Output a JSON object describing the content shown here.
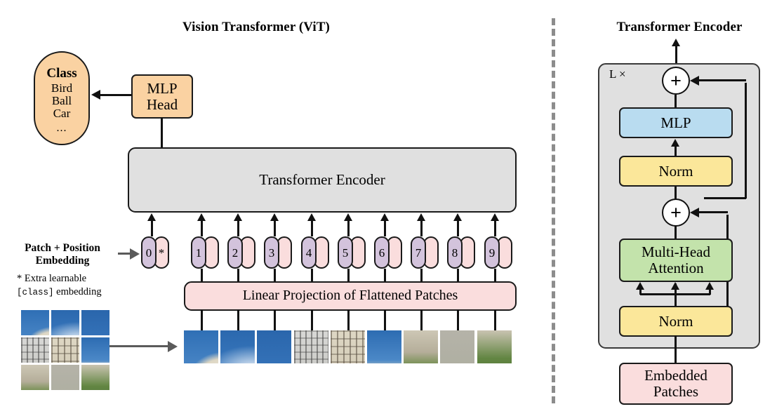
{
  "figure": {
    "left_title": "Vision Transformer (ViT)",
    "right_title": "Transformer Encoder"
  },
  "left_panel": {
    "class_box": {
      "header": "Class",
      "items": [
        "Bird",
        "Ball",
        "Car"
      ],
      "ellipsis": "...",
      "color": "#fad2a2"
    },
    "mlp_head": {
      "line1": "MLP",
      "line2": "Head",
      "color": "#fad2a2"
    },
    "encoder_box": {
      "label": "Transformer Encoder",
      "color": "#e0e0e0"
    },
    "linear_projection": {
      "label": "Linear Projection of Flattened Patches",
      "color": "#fadddd"
    },
    "embedding_label": {
      "line1": "Patch + Position",
      "line2": "Embedding"
    },
    "footnote": {
      "line1_prefix": "* Extra learnable",
      "line2_code": "[class]",
      "line2_suffix": " embedding"
    },
    "tokens": [
      {
        "number": "0",
        "extra": "*",
        "is_class_token": true
      },
      {
        "number": "1",
        "extra": "",
        "is_class_token": false
      },
      {
        "number": "2",
        "extra": "",
        "is_class_token": false
      },
      {
        "number": "3",
        "extra": "",
        "is_class_token": false
      },
      {
        "number": "4",
        "extra": "",
        "is_class_token": false
      },
      {
        "number": "5",
        "extra": "",
        "is_class_token": false
      },
      {
        "number": "6",
        "extra": "",
        "is_class_token": false
      },
      {
        "number": "7",
        "extra": "",
        "is_class_token": false
      },
      {
        "number": "8",
        "extra": "",
        "is_class_token": false
      },
      {
        "number": "9",
        "extra": "",
        "is_class_token": false
      }
    ],
    "token_colors": {
      "position": "#d3c3dc",
      "patch": "#fadddd"
    },
    "source_image": {
      "grid_rows": 3,
      "grid_cols": 3,
      "subject": "palace building with blue sky",
      "patch_count": 9
    },
    "patch_strip_count": 9
  },
  "right_panel": {
    "repeat_label": "L ×",
    "blocks": [
      {
        "label": "MLP",
        "color": "#b9dcf0"
      },
      {
        "label": "Norm",
        "color": "#fbe79a"
      },
      {
        "label_line1": "Multi-Head",
        "label_line2": "Attention",
        "color": "#c3e3ab"
      },
      {
        "label": "Norm",
        "color": "#fbe79a"
      }
    ],
    "residual_symbol": "+",
    "embedded_patches": {
      "line1": "Embedded",
      "line2": "Patches",
      "color": "#fadddd"
    },
    "panel_color": "#e0e0e0"
  },
  "divider": {
    "style": "dashed",
    "color": "#8c8c8c"
  }
}
